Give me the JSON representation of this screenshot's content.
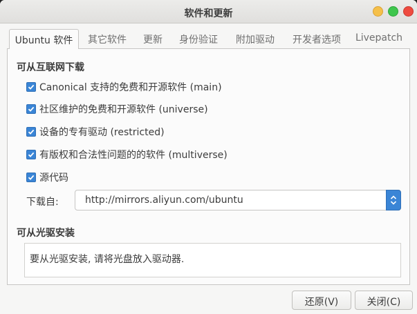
{
  "window": {
    "title": "软件和更新"
  },
  "tabs": [
    {
      "label": "Ubuntu 软件",
      "active": true
    },
    {
      "label": "其它软件",
      "active": false
    },
    {
      "label": "更新",
      "active": false
    },
    {
      "label": "身份验证",
      "active": false
    },
    {
      "label": "附加驱动",
      "active": false
    },
    {
      "label": "开发者选项",
      "active": false
    },
    {
      "label": "Livepatch",
      "active": false
    }
  ],
  "internet": {
    "title": "可从互联网下载",
    "options": [
      {
        "label": "Canonical 支持的免费和开源软件 (main)",
        "checked": true
      },
      {
        "label": "社区维护的免费和开源软件 (universe)",
        "checked": true
      },
      {
        "label": "设备的专有驱动 (restricted)",
        "checked": true
      },
      {
        "label": "有版权和合法性问题的的软件 (multiverse)",
        "checked": true
      },
      {
        "label": "源代码",
        "checked": true
      }
    ],
    "download_from_label": "下载自:",
    "download_from_value": "http://mirrors.aliyun.com/ubuntu"
  },
  "cdrom": {
    "title": "可从光驱安装",
    "message": "要从光驱安装, 请将光盘放入驱动器."
  },
  "buttons": {
    "revert": "还原(V)",
    "close": "关闭(C)"
  },
  "colors": {
    "accent": "#3a85d6",
    "background": "#f6f6f5"
  }
}
